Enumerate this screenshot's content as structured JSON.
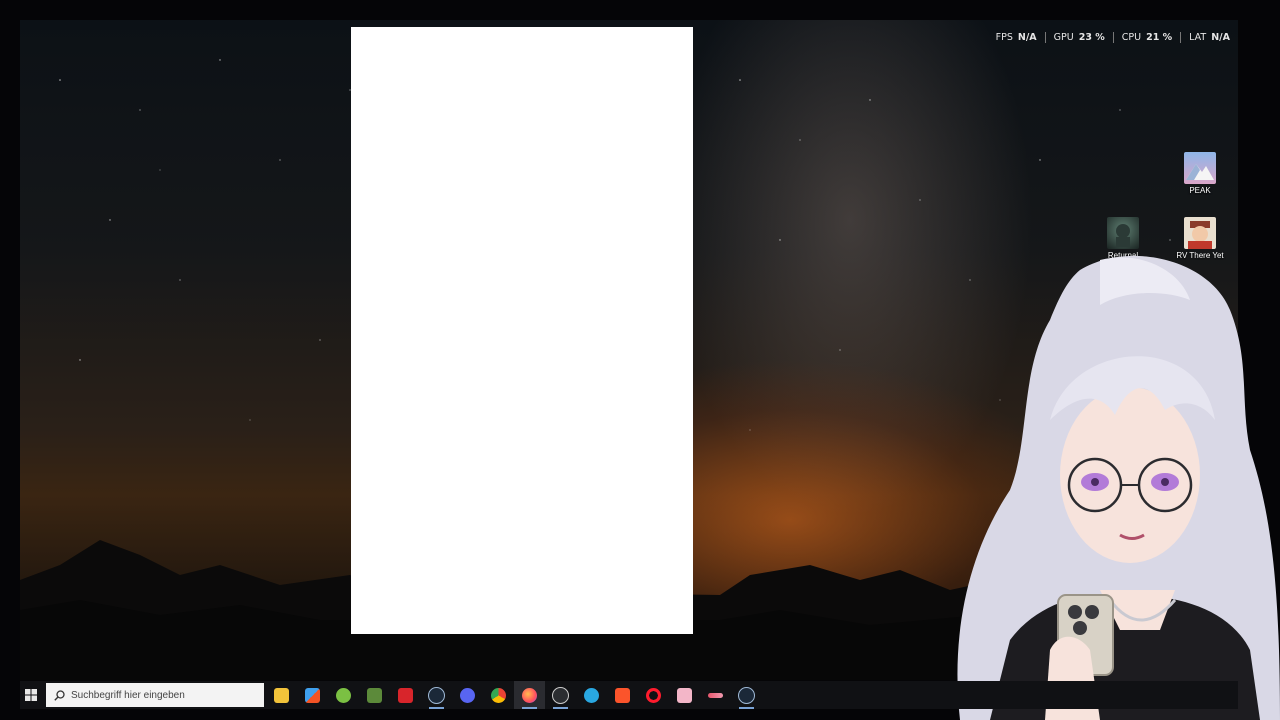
{
  "hud": {
    "fps": {
      "label": "FPS",
      "value": "N/A"
    },
    "gpu": {
      "label": "GPU",
      "value": "23 %"
    },
    "cpu": {
      "label": "CPU",
      "value": "21 %"
    },
    "lat": {
      "label": "LAT",
      "value": "N/A"
    }
  },
  "desktop_icons": {
    "peak": "PEAK",
    "returnal": "Returnal",
    "rv_there_yet": "RV There Yet"
  },
  "taskbar": {
    "search_placeholder": "Suchbegriff hier eingeben",
    "apps": [
      "file-explorer",
      "microsoft-store",
      "android-app",
      "minecraft",
      "vr-app",
      "steam",
      "discord",
      "chrome",
      "firefox",
      "speedtest",
      "app-sync",
      "brave",
      "opera",
      "anime-app",
      "chat-app",
      "steam-2"
    ],
    "active_app": "firefox",
    "accent": "#7aa3d6"
  }
}
